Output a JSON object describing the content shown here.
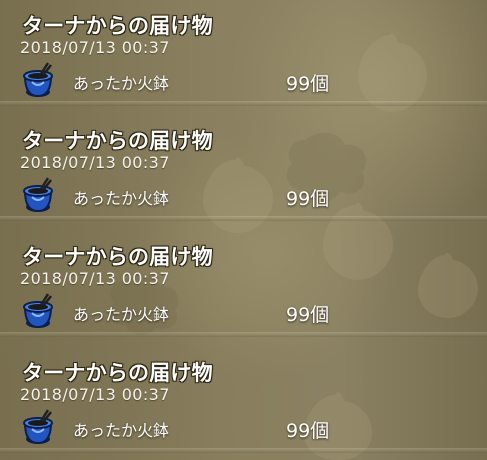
{
  "messages": [
    {
      "title": "ターナからの届け物",
      "date": "2018/07/13 00:37",
      "item_name": "あったか火鉢",
      "quantity": "99個",
      "icon": "brazier-pot-icon"
    },
    {
      "title": "ターナからの届け物",
      "date": "2018/07/13 00:37",
      "item_name": "あったか火鉢",
      "quantity": "99個",
      "icon": "brazier-pot-icon"
    },
    {
      "title": "ターナからの届け物",
      "date": "2018/07/13 00:37",
      "item_name": "あったか火鉢",
      "quantity": "99個",
      "icon": "brazier-pot-icon"
    },
    {
      "title": "ターナからの届け物",
      "date": "2018/07/13 00:37",
      "item_name": "あったか火鉢",
      "quantity": "99個",
      "icon": "brazier-pot-icon"
    }
  ]
}
